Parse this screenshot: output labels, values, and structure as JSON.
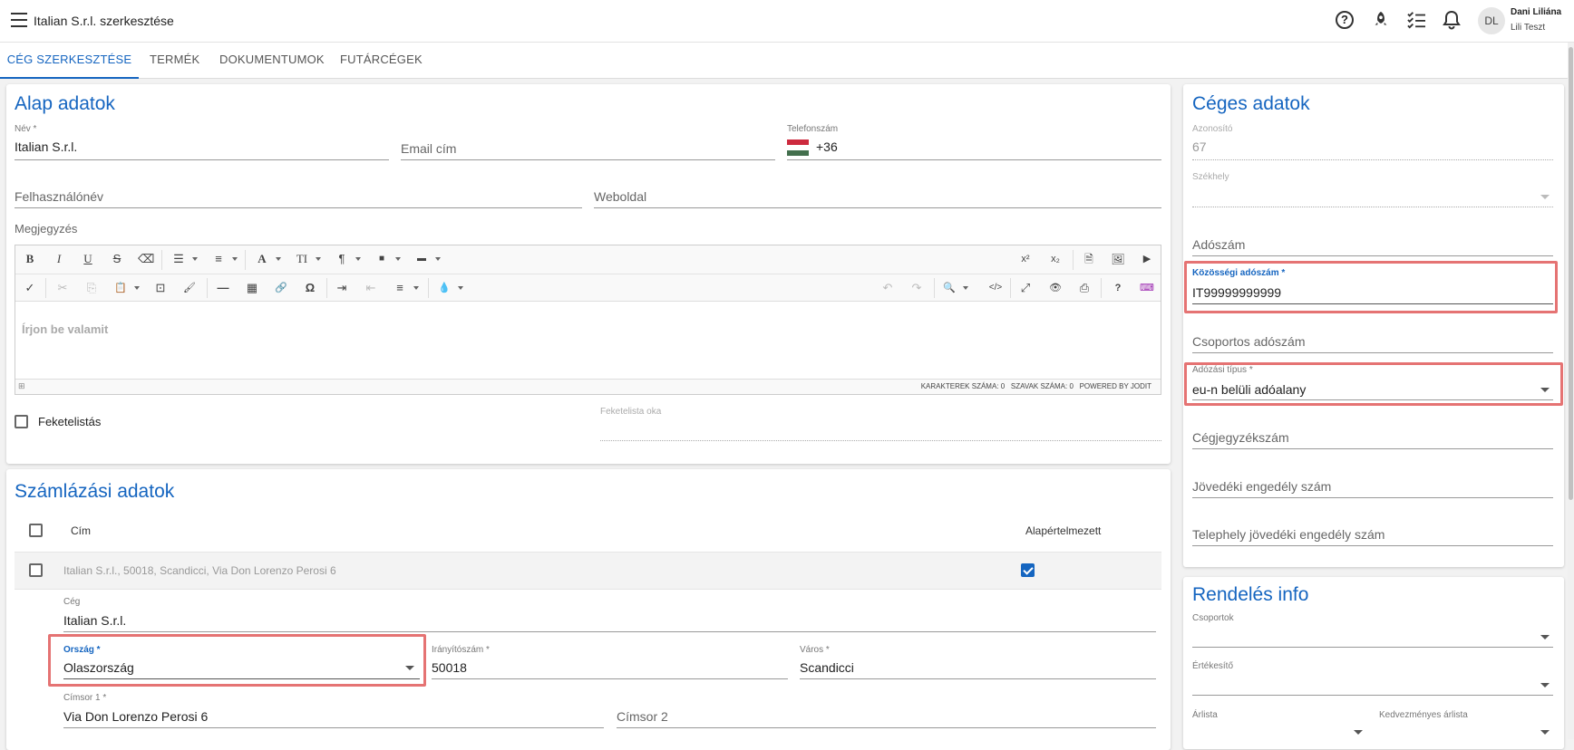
{
  "header": {
    "title": "Italian S.r.l. szerkesztése",
    "user_initials": "DL",
    "user_name": "Dani Liliána",
    "user_sub": "Lili Teszt"
  },
  "tabs": [
    {
      "label": "CÉG SZERKESZTÉSE"
    },
    {
      "label": "TERMÉK"
    },
    {
      "label": "DOKUMENTUMOK"
    },
    {
      "label": "FUTÁRCÉGEK"
    }
  ],
  "basic": {
    "title": "Alap adatok",
    "name_label": "Név *",
    "name_value": "Italian S.r.l.",
    "email_placeholder": "Email cím",
    "phone_label": "Telefonszám",
    "phone_value": "+36",
    "username_placeholder": "Felhasználónév",
    "website_placeholder": "Weboldal",
    "note_label": "Megjegyzés",
    "editor_placeholder": "Írjon be valamit",
    "editor_status": "KARAKTEREK SZÁMA: 0   SZAVAK SZÁMA: 0   POWERED BY JODIT",
    "blacklist_label": "Feketelistás",
    "blacklist_reason_label": "Feketelista oka"
  },
  "toolbar": {
    "row1": [
      "B",
      "I",
      "U",
      "S",
      "⌫",
      "☰",
      "≡",
      "A",
      "TI",
      "¶",
      "■",
      "▬"
    ],
    "row1_right": [
      "x²",
      "x₂",
      "🗎",
      "🖼",
      "▶"
    ],
    "row2": [
      "✓",
      "✂",
      "⎘",
      "📋",
      "⊡",
      "🖌",
      "—",
      "▦",
      "🔗",
      "Ω",
      "⇥",
      "⇤",
      "≡",
      "💧"
    ],
    "row2_right": [
      "↶",
      "↷",
      "🔍",
      "</>",
      "⤢",
      "👁",
      "⎙",
      "?",
      "⌨"
    ]
  },
  "billing": {
    "title": "Számlázási adatok",
    "col_address": "Cím",
    "col_default": "Alapértelmezett",
    "row_address": "Italian S.r.l., 50018, Scandicci, Via Don Lorenzo Perosi 6",
    "company_label": "Cég",
    "company_value": "Italian S.r.l.",
    "country_label": "Ország *",
    "country_value": "Olaszország",
    "zip_label": "Irányítószám *",
    "zip_value": "50018",
    "city_label": "Város *",
    "city_value": "Scandicci",
    "addr1_label": "Címsor 1 *",
    "addr1_value": "Via Don Lorenzo Perosi 6",
    "addr2_placeholder": "Címsor 2"
  },
  "company": {
    "title": "Céges adatok",
    "id_label": "Azonosító",
    "id_value": "67",
    "hq_label": "Székhely",
    "tax_placeholder": "Adószám",
    "eu_tax_label": "Közösségi adószám *",
    "eu_tax_value": "IT99999999999",
    "group_tax_placeholder": "Csoportos adószám",
    "tax_type_label": "Adózási típus *",
    "tax_type_value": "eu-n belüli adóalany",
    "reg_placeholder": "Cégjegyzékszám",
    "excise_placeholder": "Jövedéki engedély szám",
    "site_excise_placeholder": "Telephely jövedéki engedély szám"
  },
  "order": {
    "title": "Rendelés info",
    "groups_label": "Csoportok",
    "seller_label": "Értékesítő",
    "pricelist_label": "Árlista",
    "discount_pricelist_label": "Kedvezményes árlista"
  }
}
